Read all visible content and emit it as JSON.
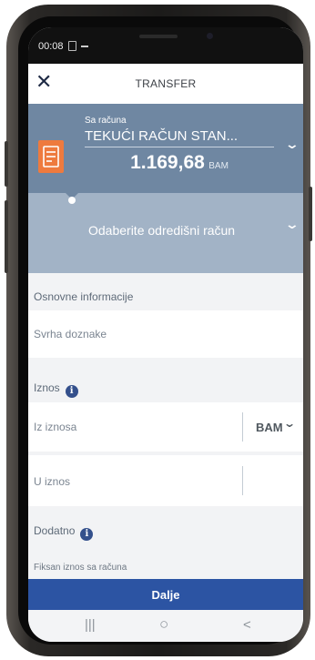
{
  "status_bar": {
    "time": "00:08"
  },
  "header": {
    "title": "TRANSFER",
    "close_icon": "close-icon"
  },
  "source_account": {
    "label": "Sa računa",
    "account_name": "TEKUĆI RAČUN STAN...",
    "balance": "1.169,68",
    "currency": "BAM",
    "icon": "document-icon",
    "accent_color": "#ee7a3e"
  },
  "destination": {
    "placeholder": "Odaberite odredišni račun"
  },
  "sections": {
    "basic_info": "Osnovne informacije",
    "purpose_placeholder": "Svrha doznake",
    "amount": "Iznos",
    "from_amount": "Iz iznosa",
    "from_currency": "BAM",
    "to_amount": "U iznos",
    "additional": "Dodatno",
    "fixed_amount": "Fiksan iznos sa računa"
  },
  "footer": {
    "next_label": "Dalje",
    "next_color": "#2c54a3"
  },
  "nav_bar": {
    "recents": "|||",
    "home": "○",
    "back": "<"
  }
}
